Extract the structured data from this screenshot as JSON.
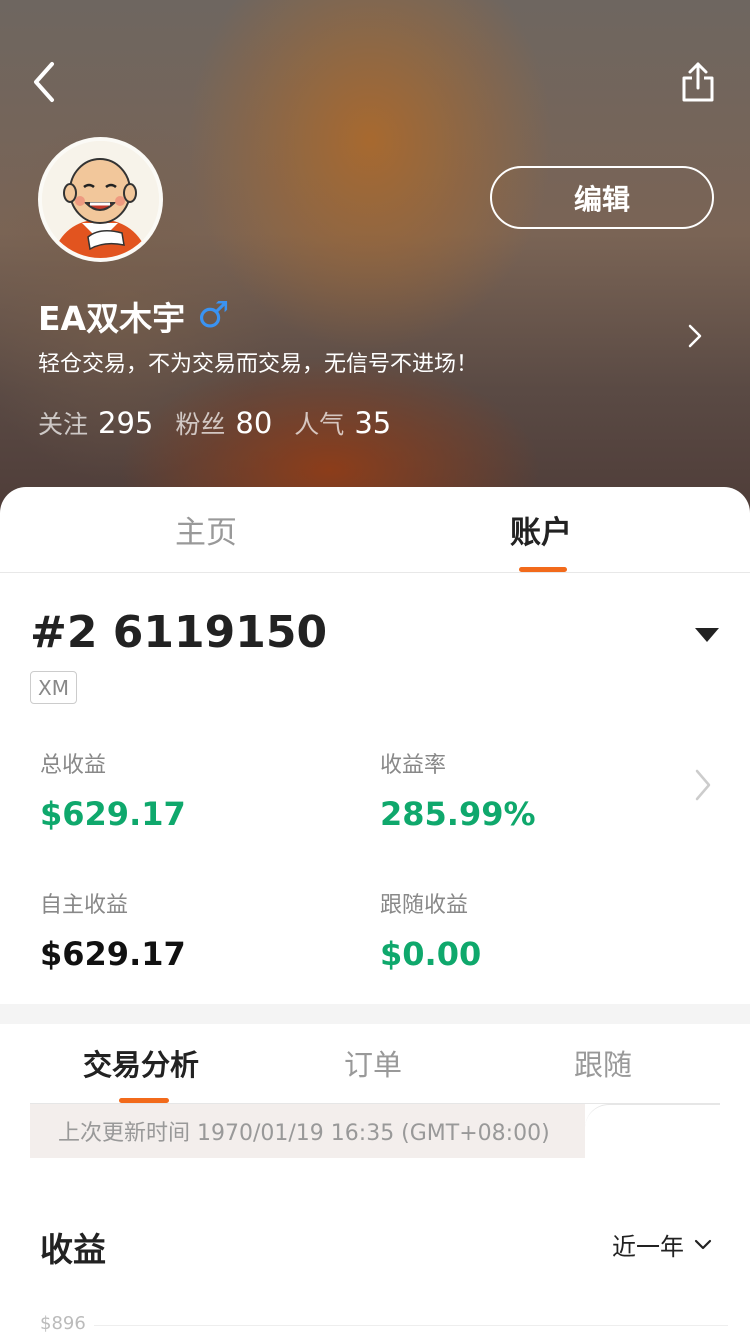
{
  "header": {
    "back_icon": "chevron-left-icon",
    "share_icon": "share-icon",
    "edit_label": "编辑",
    "username": "EA双木宇",
    "gender_symbol": "♂",
    "bio": "轻仓交易，不为交易而交易，无信号不进场！",
    "stats": [
      {
        "label": "关注",
        "value": "295"
      },
      {
        "label": "粉丝",
        "value": "80"
      },
      {
        "label": "人气",
        "value": "35"
      }
    ]
  },
  "top_tabs": [
    {
      "label": "主页",
      "active": false
    },
    {
      "label": "账户",
      "active": true
    }
  ],
  "account": {
    "number": "#2 6119150",
    "broker": "XM",
    "metrics": {
      "total_profit": {
        "label": "总收益",
        "value": "$629.17"
      },
      "return_rate": {
        "label": "收益率",
        "value": "285.99%"
      },
      "own_profit": {
        "label": "自主收益",
        "value": "$629.17"
      },
      "follow_profit": {
        "label": "跟随收益",
        "value": "$0.00"
      }
    }
  },
  "sub_tabs": [
    {
      "label": "交易分析",
      "active": true
    },
    {
      "label": "订单",
      "active": false
    },
    {
      "label": "跟随",
      "active": false
    }
  ],
  "update_text": "上次更新时间 1970/01/19 16:35 (GMT+08:00)",
  "profit_section": {
    "title": "收益",
    "period": "近一年",
    "y_max_label": "$896"
  },
  "colors": {
    "accent": "#f26a1b",
    "positive": "#0fa86c",
    "gender": "#3a93f2"
  }
}
